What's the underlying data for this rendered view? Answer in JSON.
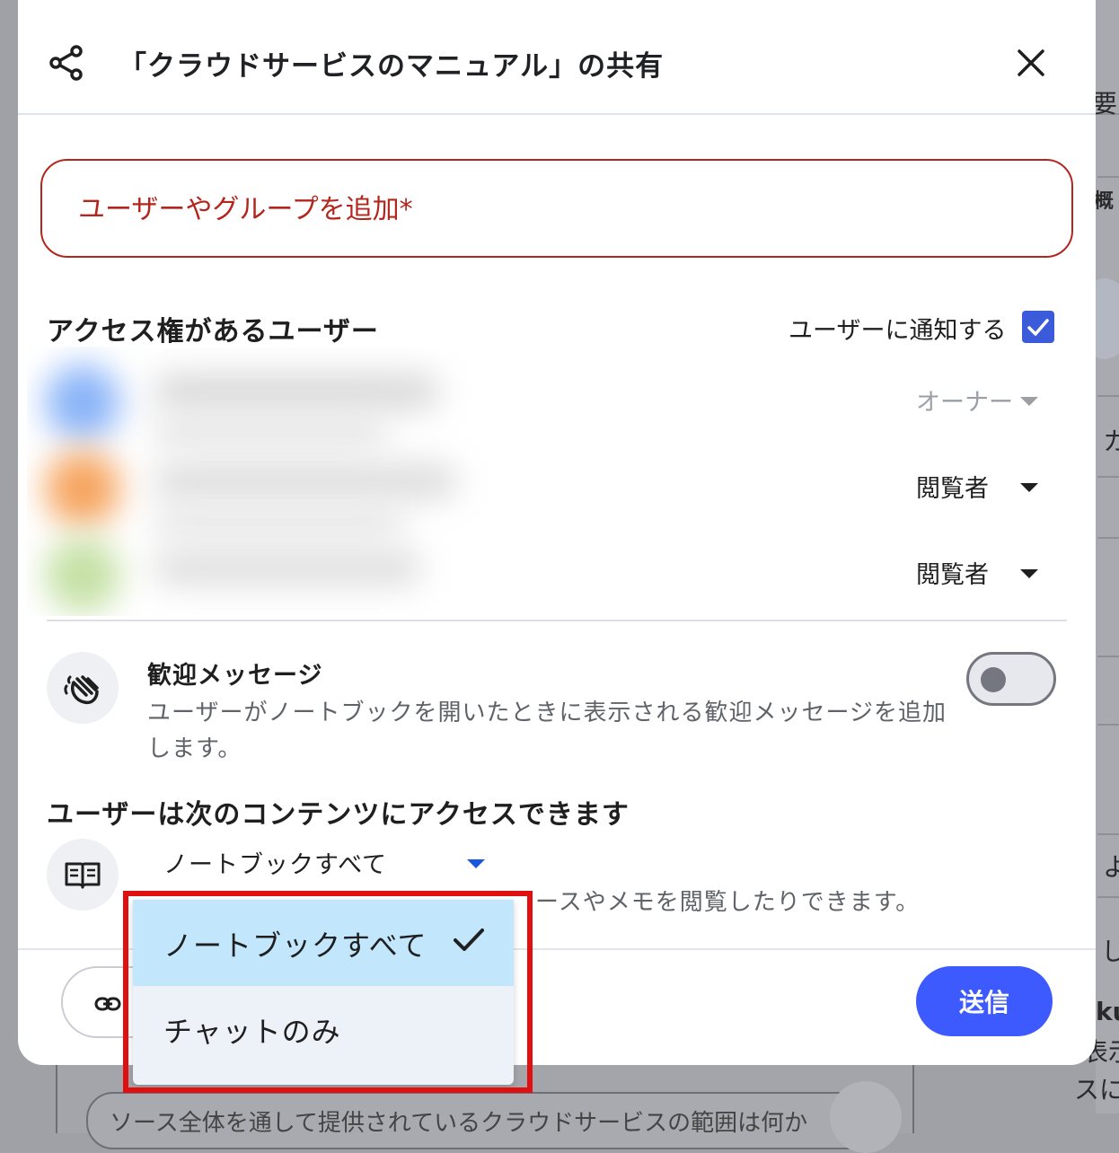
{
  "background": {
    "right_text_1": "要",
    "right_text_2": "概",
    "right_text_3": "カ",
    "right_text_4": "よ",
    "right_text_5": "し",
    "right_text_6": "ku",
    "right_text_7": "表示",
    "right_text_8": "スに",
    "bottom_pill_text": "ソース全体を通して提供されているクラウドサービスの範囲は何か"
  },
  "dialog": {
    "title": "「クラウドサービスのマニュアル」の共有",
    "add_field_placeholder": "ユーザーやグループを追加*",
    "access_section_title": "アクセス権があるユーザー",
    "notify_label": "ユーザーに通知する",
    "notify_checked": true,
    "users": [
      {
        "role": "オーナー",
        "disabled": true,
        "avatar_color": "#8ab4f8"
      },
      {
        "role": "閲覧者",
        "disabled": false,
        "avatar_color": "#f6a560"
      },
      {
        "role": "閲覧者",
        "disabled": false,
        "avatar_color": "#c5e1a5"
      }
    ],
    "welcome_title": "歓迎メッセージ",
    "welcome_desc": "ユーザーがノートブックを開いたときに表示される歓迎メッセージを追加します。",
    "welcome_enabled": false,
    "content_access_title": "ユーザーは次のコンテンツにアクセスできます",
    "content_access_value": "ノートブックすべて",
    "content_access_desc_visible": "ースやメモを閲覧したりできます。",
    "send_label": "送信"
  },
  "menu": {
    "items": [
      {
        "label": "ノートブックすべて",
        "selected": true
      },
      {
        "label": "チャットのみ",
        "selected": false
      }
    ]
  },
  "colors": {
    "primary": "#3d5afe",
    "error": "#b3261e",
    "highlight": "#e01010",
    "menu_selected": "#c2e6fb"
  }
}
